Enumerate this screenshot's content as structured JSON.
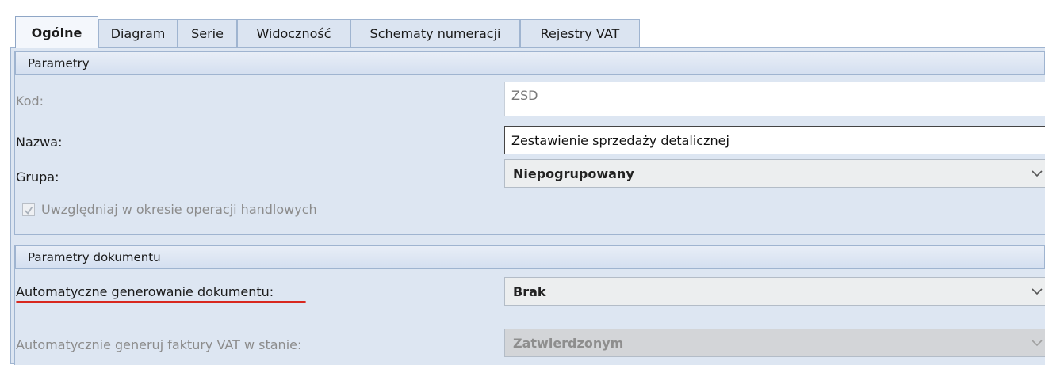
{
  "tabs": [
    {
      "label": "Ogólne",
      "active": true
    },
    {
      "label": "Diagram",
      "active": false
    },
    {
      "label": "Serie",
      "active": false
    },
    {
      "label": "Widoczność",
      "active": false
    },
    {
      "label": "Schematy numeracji",
      "active": false
    },
    {
      "label": "Rejestry VAT",
      "active": false
    }
  ],
  "parametry": {
    "header": "Parametry",
    "kod_label": "Kod:",
    "kod_value": "ZSD",
    "nazwa_label": "Nazwa:",
    "nazwa_value": "Zestawienie sprzedaży detalicznej",
    "grupa_label": "Grupa:",
    "grupa_value": "Niepogrupowany",
    "uwzgledniaj_label": "Uwzględniaj w okresie operacji handlowych",
    "uwzgledniaj_checked": true
  },
  "parametry_dokumentu": {
    "header": "Parametry dokumentu",
    "auto_gen_label": "Automatyczne generowanie dokumentu:",
    "auto_gen_value": "Brak",
    "auto_vat_label": "Automatycznie generuj faktury VAT w stanie:",
    "auto_vat_value": "Zatwierdzonym"
  },
  "colors": {
    "panel": "#dde6f2",
    "tab_border": "#9fb4d0",
    "highlight_underline": "#d8281f"
  }
}
